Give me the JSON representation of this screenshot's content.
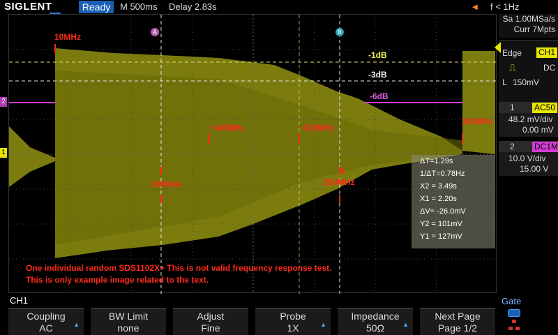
{
  "topbar": {
    "brand": "SIGLENT",
    "run_state": "Ready",
    "timebase": "M 500ms",
    "delay": "Delay 2.83s",
    "frequency": "f < 1Hz"
  },
  "acquisition": {
    "sample_rate": "Sa 1.00MSa/s",
    "memory": "Curr 7Mpts"
  },
  "trigger": {
    "type": "Edge",
    "source": "CH1",
    "coupling": "DC",
    "level_prefix": "L",
    "level": "150mV"
  },
  "channel1": {
    "number": "1",
    "coupling": "AC50",
    "scale": "48.2 mV/div",
    "offset": "0.00 mV",
    "color": "#e6e600"
  },
  "channel2": {
    "number": "2",
    "coupling": "DC1M",
    "scale": "10.0 V/div",
    "offset": "15.00 V",
    "color": "#d63bd6"
  },
  "markers": {
    "trace_a": "A",
    "trace_b": "B",
    "ch1_marker": "1",
    "ch2_marker": "2"
  },
  "frequency_annotations": [
    "10MHz",
    "~140MHz",
    "~220MHz",
    "360MHz",
    "100MHz",
    "250MHz",
    "N"
  ],
  "db_levels": [
    "-1dB",
    "-3dB",
    "-6dB"
  ],
  "measurements": {
    "delta_t": "ΔT=1.29s",
    "inv_delta_t": "1/ΔT=0.78Hz",
    "x2": "X2 = 3.49s",
    "x1": "X1 = 2.20s",
    "delta_v": "ΔV= -26.0mV",
    "y2": "Y2 = 101mV",
    "y1": "Y1 = 127mV"
  },
  "notes": {
    "line1": "One individual random SDS1102X+ This is not valid frequency response test.",
    "line2": "This is only example image related to the text."
  },
  "bottom": {
    "active_channel": "CH1",
    "gate": "Gate"
  },
  "softkeys": [
    {
      "label": "Coupling",
      "value": "AC",
      "has_arrow": true
    },
    {
      "label": "BW Limit",
      "value": "none",
      "has_arrow": false
    },
    {
      "label": "Adjust",
      "value": "Fine",
      "has_arrow": false
    },
    {
      "label": "Probe",
      "value": "1X",
      "has_arrow": true
    },
    {
      "label": "Impedance",
      "value": "50Ω",
      "has_arrow": true
    },
    {
      "label": "Next Page",
      "value": "Page 1/2",
      "has_arrow": false
    }
  ],
  "colors": {
    "trace": "#8a8a10",
    "marker_dashed": "#e0e070",
    "annotation_red": "#ff2a1a",
    "run_state_bg": "#1a5fb4"
  }
}
